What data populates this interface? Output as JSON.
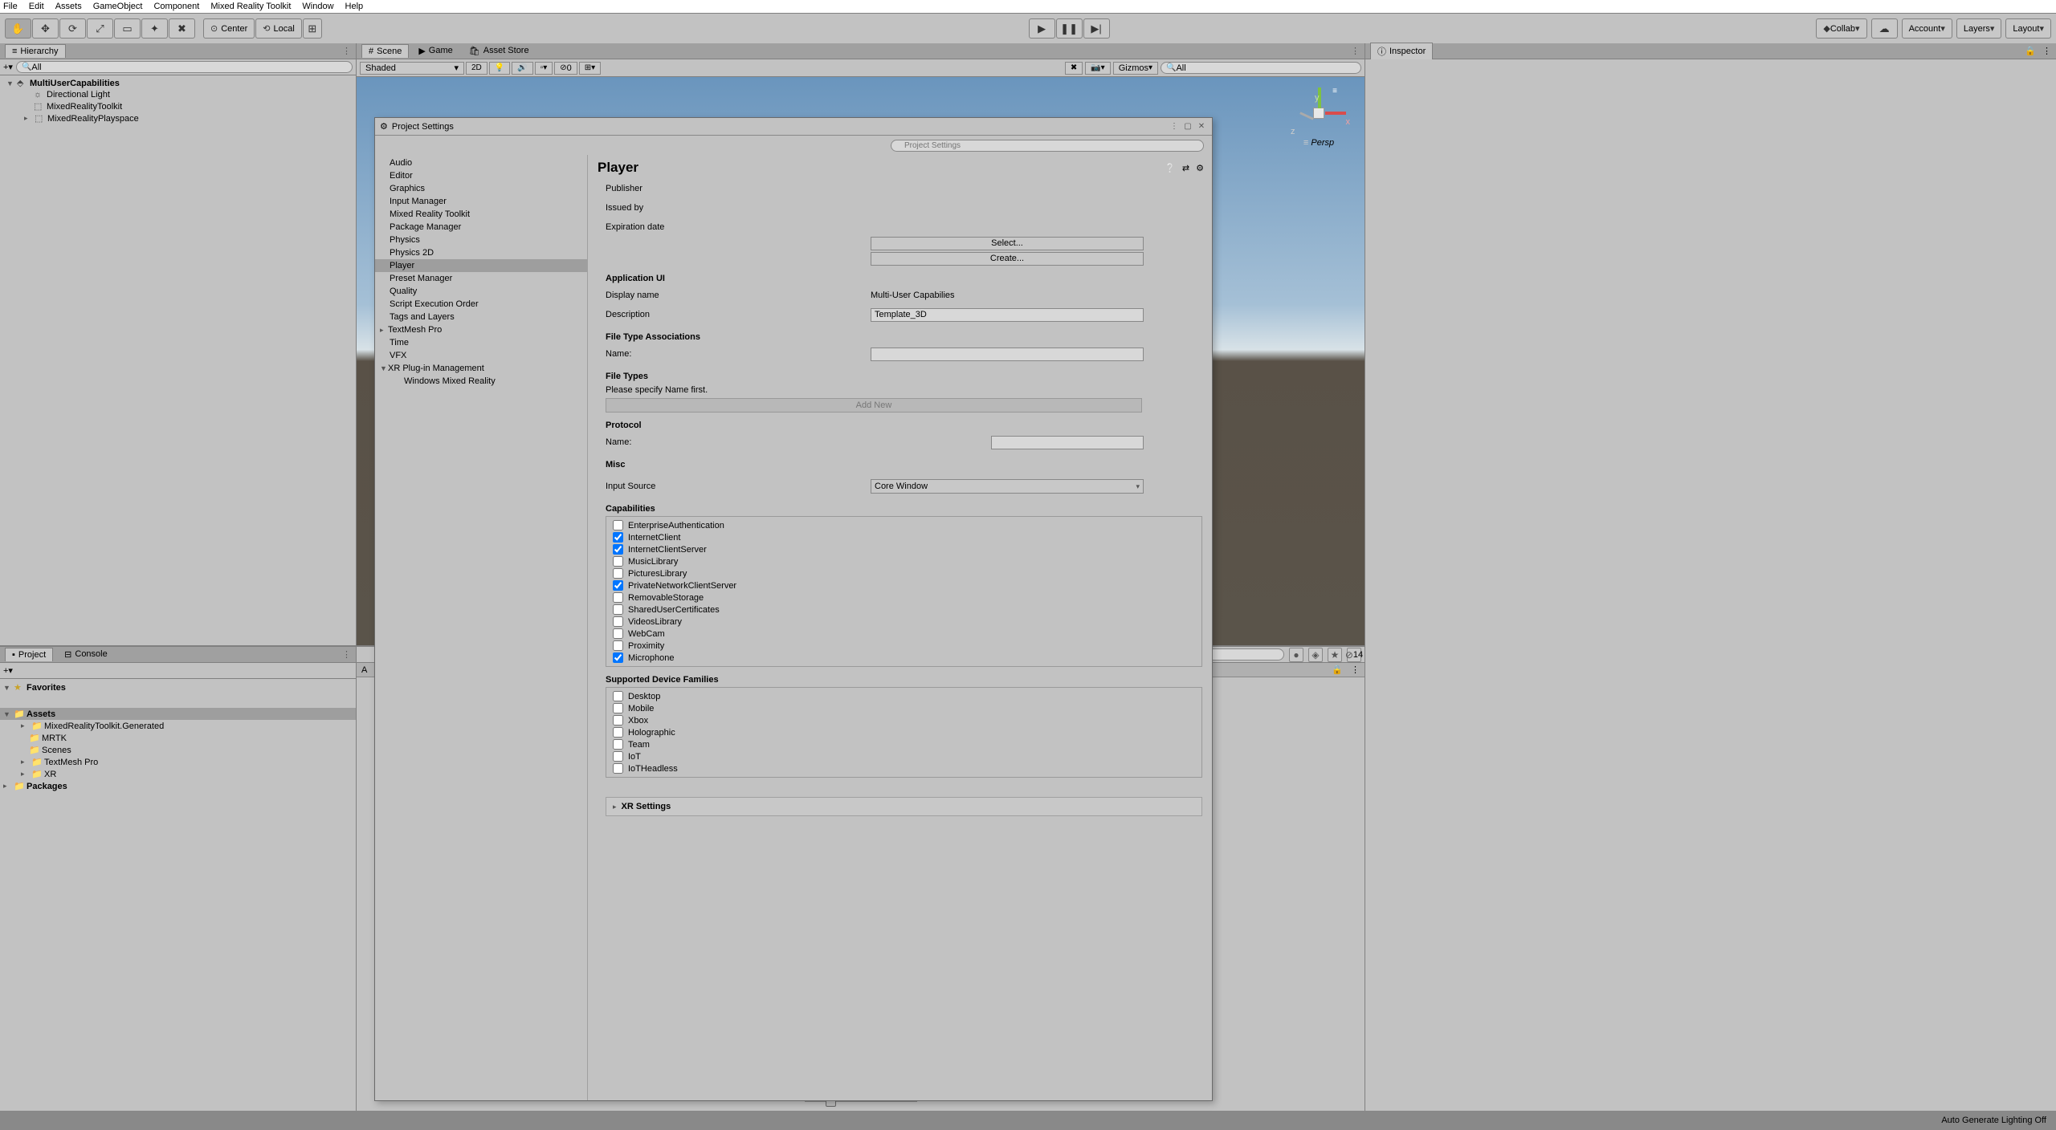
{
  "menu": {
    "file": "File",
    "edit": "Edit",
    "assets": "Assets",
    "gameObject": "GameObject",
    "component": "Component",
    "mrtk": "Mixed Reality Toolkit",
    "window": "Window",
    "help": "Help"
  },
  "toolbar": {
    "pivot_center": "Center",
    "pivot_local": "Local",
    "collab": "Collab",
    "account": "Account",
    "layers": "Layers",
    "layout": "Layout"
  },
  "hierarchy": {
    "tab": "Hierarchy",
    "search_placeholder": "All",
    "root": "MultiUserCapabilities",
    "children": [
      "Directional Light",
      "MixedRealityToolkit",
      "MixedRealityPlayspace"
    ]
  },
  "sceneTabs": {
    "scene": "Scene",
    "game": "Game",
    "asset_store": "Asset Store"
  },
  "sceneToolbar": {
    "shaded": "Shaded",
    "mode2d": "2D",
    "gizmos": "Gizmos",
    "search_placeholder": "All",
    "hidden_count": "0"
  },
  "gizmo": {
    "persp": "Persp",
    "x": "x",
    "y": "y",
    "z": "z"
  },
  "project": {
    "tab_project": "Project",
    "tab_console": "Console",
    "favorites": "Favorites",
    "assets": "Assets",
    "assets_children": [
      "MixedRealityToolkit.Generated",
      "MRTK",
      "Scenes",
      "TextMesh Pro",
      "XR"
    ],
    "packages": "Packages",
    "content_header": "A",
    "hidden_badge": "14"
  },
  "inspector": {
    "tab": "Inspector"
  },
  "statusbar": {
    "text": "Auto Generate Lighting Off"
  },
  "ps": {
    "title": "Project Settings",
    "sidebar": [
      "Audio",
      "Editor",
      "Graphics",
      "Input Manager",
      "Mixed Reality Toolkit",
      "Package Manager",
      "Physics",
      "Physics 2D",
      "Player",
      "Preset Manager",
      "Quality",
      "Script Execution Order",
      "Tags and Layers",
      "TextMesh Pro",
      "Time",
      "VFX",
      "XR Plug-in Management"
    ],
    "sidebar_child": "Windows Mixed Reality",
    "selected": "Player",
    "header": "Player",
    "publisher": "Publisher",
    "issued": "Issued by",
    "expiration": "Expiration date",
    "select_btn": "Select...",
    "create_btn": "Create...",
    "app_ui": "Application UI",
    "display_name_lbl": "Display name",
    "display_name_val": "Multi-User Capabilies",
    "description_lbl": "Description",
    "description_val": "Template_3D",
    "file_type_assoc": "File Type Associations",
    "name_lbl": "Name:",
    "file_types": "File Types",
    "file_types_msg": "Please specify Name first.",
    "add_new": "Add New",
    "protocol": "Protocol",
    "misc": "Misc",
    "input_source_lbl": "Input Source",
    "input_source_val": "Core Window",
    "capabilities": "Capabilities",
    "caps": [
      {
        "label": "EnterpriseAuthentication",
        "checked": false
      },
      {
        "label": "InternetClient",
        "checked": true
      },
      {
        "label": "InternetClientServer",
        "checked": true
      },
      {
        "label": "MusicLibrary",
        "checked": false
      },
      {
        "label": "PicturesLibrary",
        "checked": false
      },
      {
        "label": "PrivateNetworkClientServer",
        "checked": true
      },
      {
        "label": "RemovableStorage",
        "checked": false
      },
      {
        "label": "SharedUserCertificates",
        "checked": false
      },
      {
        "label": "VideosLibrary",
        "checked": false
      },
      {
        "label": "WebCam",
        "checked": false
      },
      {
        "label": "Proximity",
        "checked": false
      },
      {
        "label": "Microphone",
        "checked": true
      }
    ],
    "supported_families": "Supported Device Families",
    "families": [
      {
        "label": "Desktop",
        "checked": false
      },
      {
        "label": "Mobile",
        "checked": false
      },
      {
        "label": "Xbox",
        "checked": false
      },
      {
        "label": "Holographic",
        "checked": false
      },
      {
        "label": "Team",
        "checked": false
      },
      {
        "label": "IoT",
        "checked": false
      },
      {
        "label": "IoTHeadless",
        "checked": false
      }
    ],
    "xr_settings": "XR Settings"
  }
}
